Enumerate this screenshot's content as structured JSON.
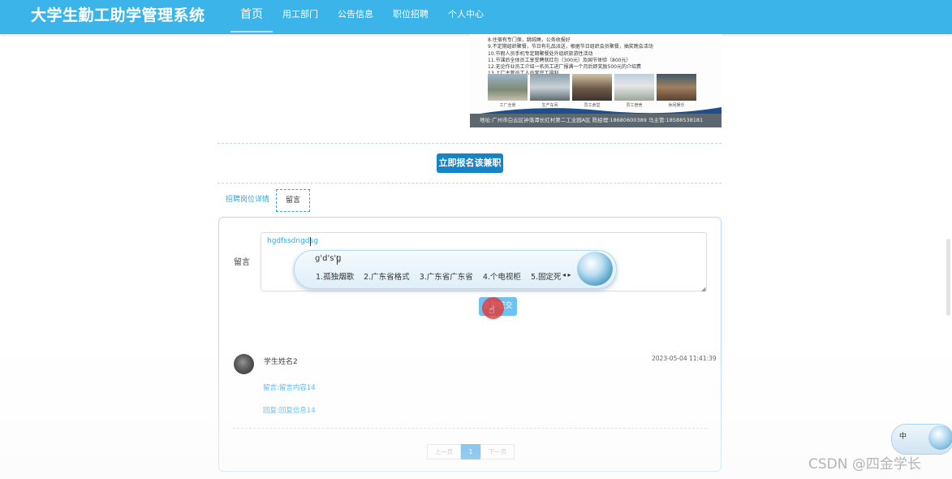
{
  "brand": "大学生勤工助学管理系统",
  "nav": [
    "首页",
    "用工部门",
    "公告信息",
    "职位招聘",
    "个人中心"
  ],
  "poster": {
    "lines": [
      "8.住宿有专门保，跳绒绳，公务收报好",
      "9.不定期组织聚餐，节日有礼品派送，根据节日组织会员聚餐，抽奖晚会活动",
      "10.节假人员手机专定期聚餐处外组织旅游性活动",
      "11.节课后全体员工享受聘就红包（300元）及国节体验（800元）",
      "12.无论作业员工介绍一名员工进厂报满一个月后即奖励500元的介绍费",
      "13.上厂主管员工人员常完工福利"
    ],
    "captions": [
      "工厂全景",
      "生产车间",
      "员工食堂",
      "员工宿舍",
      "休闲娱乐"
    ],
    "footer": "地址:广州市白云区钟落潭长红村第二工业园A区   陈经理:18680600389  马主管:18588538181"
  },
  "apply_button": "立即报名该兼职",
  "tabs": [
    "招聘岗位详情",
    "留言"
  ],
  "form": {
    "label": "留言",
    "value": "hgdfssdngdsg",
    "submit": "立即提交"
  },
  "ime": {
    "composition": "g'd's'g",
    "candidates": [
      "1.孤独烟歌",
      "2.广东省格式",
      "3.广东省广东省",
      "4.个电视柜",
      "5.固定死"
    ],
    "arrows": "◂ ▸",
    "mini_label": "中"
  },
  "comment": {
    "name": "学生姓名2",
    "time": "2023-05-04 11:41:39",
    "message": "留言:留言内容14",
    "reply": "回复:回复信息14"
  },
  "pager": {
    "prev": "上一页",
    "current": "1",
    "next": "下一页"
  },
  "watermark": "CSDN @四金学长"
}
